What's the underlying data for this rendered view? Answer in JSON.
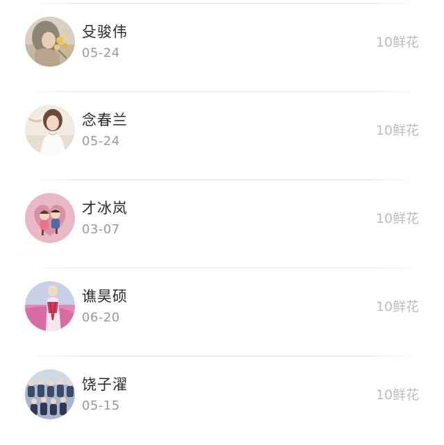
{
  "items": [
    {
      "name": "殳骏伟",
      "date": "05-24",
      "flowers": "10鲜花",
      "avatar_icon": "avatar-girl-with-flowers-icon"
    },
    {
      "name": "念春兰",
      "date": "05-24",
      "flowers": "10鲜花",
      "avatar_icon": "avatar-girl-portrait-icon"
    },
    {
      "name": "才冰岚",
      "date": "03-07",
      "flowers": "10鲜花",
      "avatar_icon": "avatar-cartoon-couple-heart-icon"
    },
    {
      "name": "谯昊硕",
      "date": "06-20",
      "flowers": "10鲜花",
      "avatar_icon": "avatar-girl-pink-scene-icon"
    },
    {
      "name": "饶子濯",
      "date": "05-15",
      "flowers": "10鲜花",
      "avatar_icon": "avatar-group-photo-icon"
    }
  ]
}
